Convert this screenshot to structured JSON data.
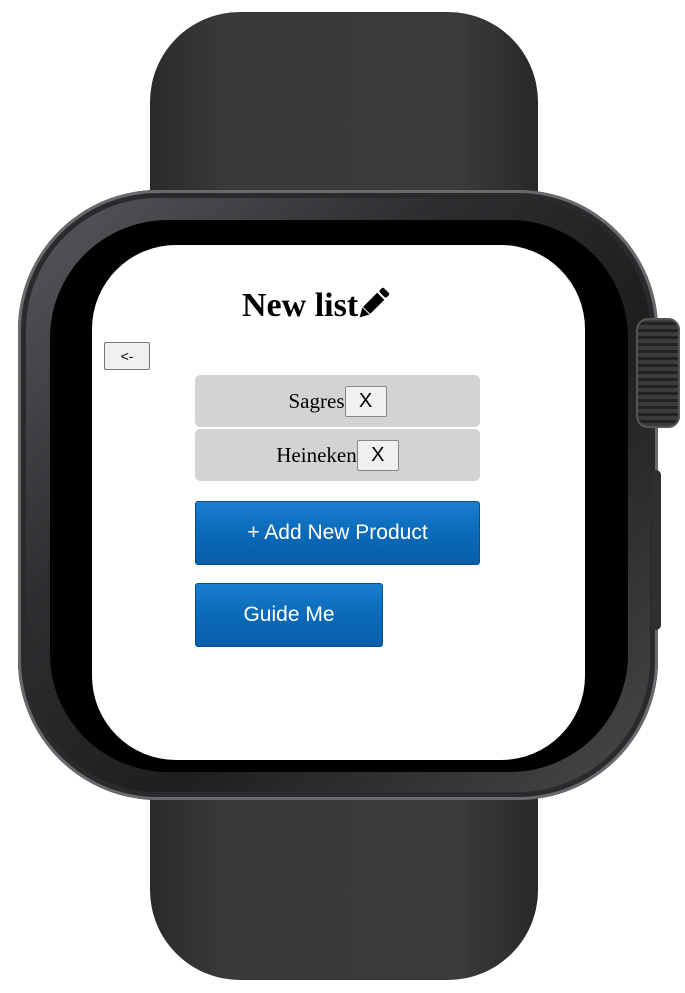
{
  "header": {
    "title": "New list",
    "edit_icon": "pencil-icon"
  },
  "nav": {
    "back_label": "<-"
  },
  "products": [
    {
      "name": "Sagres",
      "remove_label": "X"
    },
    {
      "name": "Heineken",
      "remove_label": "X"
    }
  ],
  "actions": {
    "add_label": "+ Add New Product",
    "guide_label": "Guide Me"
  },
  "colors": {
    "accent": "#0b6ab9",
    "item_background": "#d3d3d3"
  }
}
